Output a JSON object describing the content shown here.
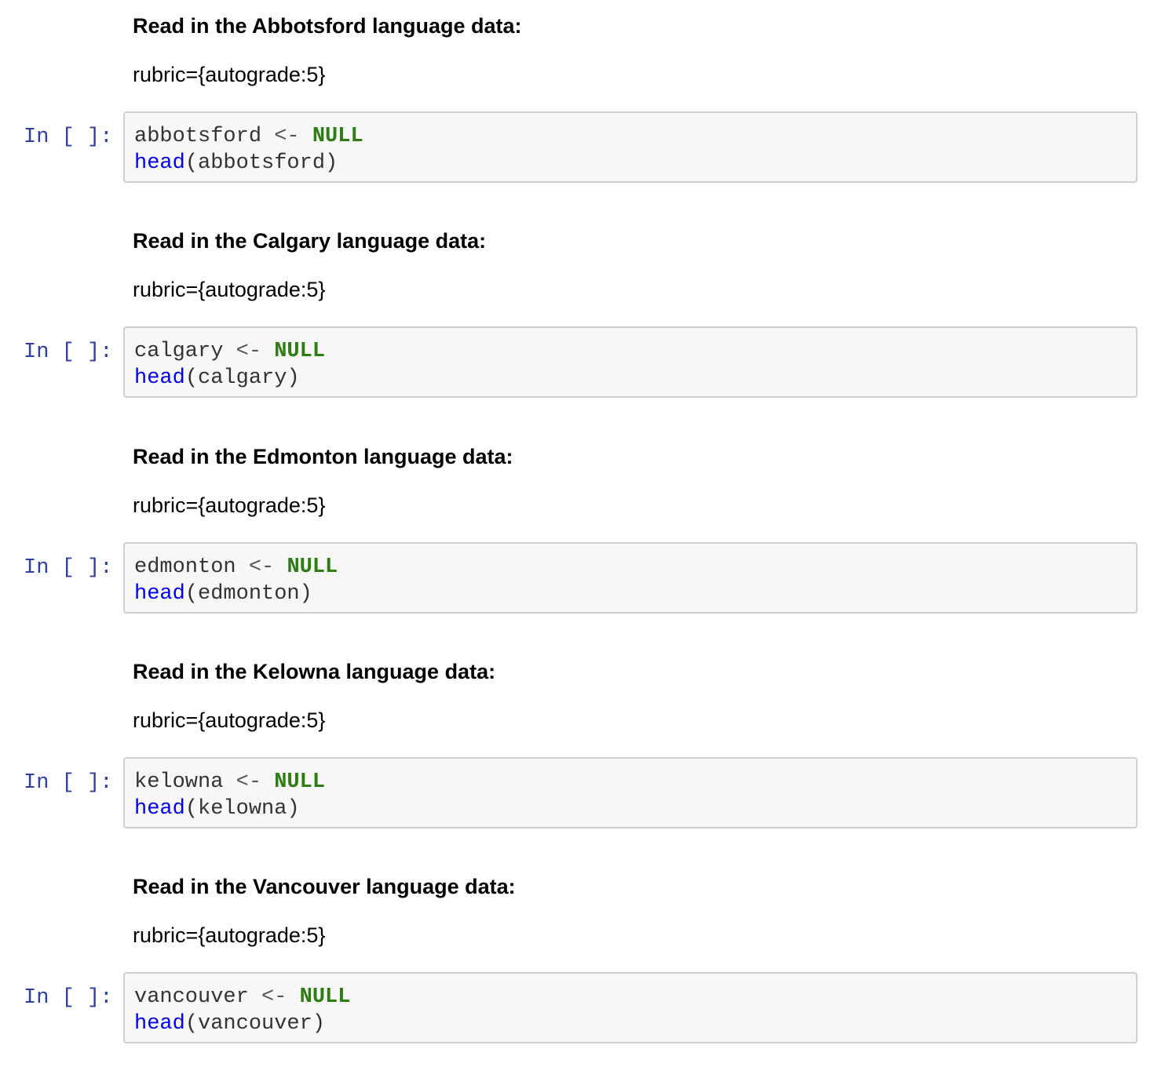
{
  "cells": [
    {
      "heading": "Read in the Abbotsford language data:",
      "rubric": "rubric={autograde:5}",
      "prompt": "In [ ]:",
      "var": "abbotsford",
      "assign_op": "<-",
      "value": "NULL",
      "func": "head",
      "open_paren": "(",
      "arg": "abbotsford",
      "close_paren": ")"
    },
    {
      "heading": "Read in the Calgary language data:",
      "rubric": "rubric={autograde:5}",
      "prompt": "In [ ]:",
      "var": "calgary",
      "assign_op": "<-",
      "value": "NULL",
      "func": "head",
      "open_paren": "(",
      "arg": "calgary",
      "close_paren": ")"
    },
    {
      "heading": "Read in the Edmonton language data:",
      "rubric": "rubric={autograde:5}",
      "prompt": "In [ ]:",
      "var": "edmonton",
      "assign_op": "<-",
      "value": "NULL",
      "func": "head",
      "open_paren": "(",
      "arg": "edmonton",
      "close_paren": ")"
    },
    {
      "heading": "Read in the Kelowna language data:",
      "rubric": "rubric={autograde:5}",
      "prompt": "In [ ]:",
      "var": "kelowna",
      "assign_op": "<-",
      "value": "NULL",
      "func": "head",
      "open_paren": "(",
      "arg": "kelowna",
      "close_paren": ")"
    },
    {
      "heading": "Read in the Vancouver language data:",
      "rubric": "rubric={autograde:5}",
      "prompt": "In [ ]:",
      "var": "vancouver",
      "assign_op": "<-",
      "value": "NULL",
      "func": "head",
      "open_paren": "(",
      "arg": "vancouver",
      "close_paren": ")"
    }
  ],
  "colors": {
    "prompt": "#303f9f",
    "null_keyword": "#2e7d12",
    "function": "#0000ee",
    "cell_background": "#f7f7f7",
    "cell_border": "#cfcfcf"
  }
}
